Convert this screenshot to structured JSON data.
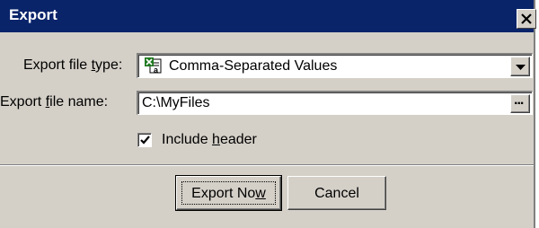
{
  "dialog": {
    "title": "Export",
    "close_label": "×"
  },
  "form": {
    "file_type": {
      "label_pre": "Export file ",
      "label_accel": "t",
      "label_post": "ype:",
      "value": "Comma-Separated Values",
      "icon": "excel-file-icon"
    },
    "file_name": {
      "label_pre": "Export ",
      "label_accel": "f",
      "label_post": "ile name:",
      "value": "C:\\MyFiles",
      "browse_label": "..."
    },
    "include_header": {
      "label_pre": "Include ",
      "label_accel": "h",
      "label_post": "eader",
      "checked": true
    }
  },
  "buttons": {
    "export_now": {
      "label_pre": "Export No",
      "label_accel": "w",
      "label_post": ""
    },
    "cancel": {
      "label": "Cancel"
    }
  },
  "colors": {
    "titlebar": "#0a246a",
    "face": "#d4d0c8",
    "excel_green": "#1f7a1f"
  }
}
